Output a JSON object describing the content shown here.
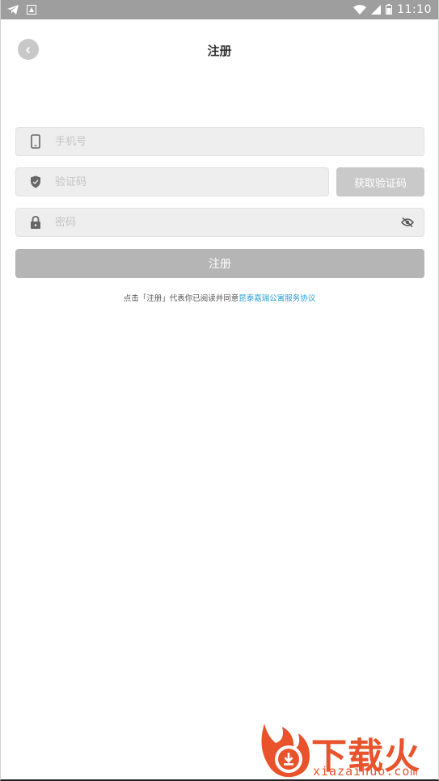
{
  "status_bar": {
    "time": "11:10",
    "icons": [
      "telegram-icon",
      "app-notification-icon",
      "wifi-icon",
      "signal-icon",
      "battery-icon"
    ]
  },
  "header": {
    "title": "注册",
    "back_icon": "chevron-left-icon"
  },
  "form": {
    "phone": {
      "placeholder": "手机号",
      "value": "",
      "icon": "phone-icon"
    },
    "code": {
      "placeholder": "验证码",
      "value": "",
      "icon": "shield-icon"
    },
    "get_code_label": "获取验证码",
    "password": {
      "placeholder": "密码",
      "value": "",
      "icon": "lock-icon",
      "toggle_icon": "eye-off-icon"
    },
    "register_label": "注册"
  },
  "agreement": {
    "prefix": "点击「注册」代表你已阅读并同意",
    "link": "昆泰嘉瑞公寓服务协议"
  },
  "watermark": {
    "brand": "下载火",
    "domain": "xiazaihuo.com"
  },
  "colors": {
    "status_bar": "#9e9e9e",
    "field_bg": "#eeeeee",
    "button_disabled": "#b5b5b5",
    "link": "#2a9fd8",
    "brand": "#e8532b"
  }
}
